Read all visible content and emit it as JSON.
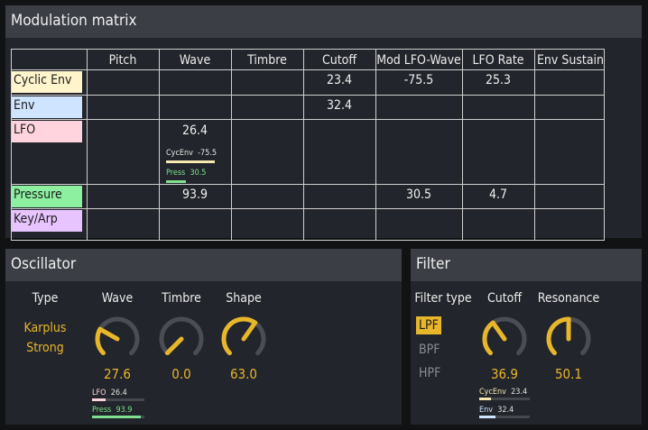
{
  "modulation": {
    "title": "Modulation matrix",
    "columns": [
      "Pitch",
      "Wave",
      "Timbre",
      "Cutoff",
      "Mod LFO-Wave",
      "LFO Rate",
      "Env Sustain"
    ],
    "rows": [
      {
        "label": "Cyclic Env",
        "color": "#fff4cc",
        "cells": [
          "",
          "",
          "",
          "23.4",
          "-75.5",
          "25.3",
          ""
        ]
      },
      {
        "label": "Env",
        "color": "#cfe4ff",
        "cells": [
          "",
          "",
          "",
          "32.4",
          "",
          "",
          ""
        ]
      },
      {
        "label": "LFO",
        "color": "#ffd4df",
        "cells": [
          "",
          "26.4",
          "",
          "",
          "",
          "",
          ""
        ]
      },
      {
        "label": "Pressure",
        "color": "#8df0a0",
        "cells": [
          "",
          "93.9",
          "",
          "",
          "30.5",
          "4.7",
          ""
        ]
      },
      {
        "label": "Key/Arp",
        "color": "#e8c4ff",
        "cells": [
          "",
          "",
          "",
          "",
          "",
          "",
          ""
        ]
      }
    ],
    "lfo_wave_submods": [
      {
        "label": "CycEnv",
        "value": "-75.5",
        "amount": -0.755,
        "color": "#f4e8b0"
      },
      {
        "label": "Press",
        "value": "30.5",
        "amount": 0.305,
        "color": "#7ee08e"
      }
    ]
  },
  "oscillator": {
    "title": "Oscillator",
    "type_label": "Type",
    "type_value_line1": "Karplus",
    "type_value_line2": "Strong",
    "knobs": [
      {
        "label": "Wave",
        "value": "27.6",
        "level": 0.276
      },
      {
        "label": "Timbre",
        "value": "0.0",
        "level": 0.0
      },
      {
        "label": "Shape",
        "value": "63.0",
        "level": 0.63
      }
    ],
    "wave_mods": [
      {
        "label": "LFO",
        "value": "26.4",
        "amount": 0.264,
        "color": "#ffd4df"
      },
      {
        "label": "Press",
        "value": "93.9",
        "amount": 0.939,
        "color": "#7ee08e"
      }
    ]
  },
  "filter": {
    "title": "Filter",
    "type_label": "Filter type",
    "types": [
      "LPF",
      "BPF",
      "HPF"
    ],
    "selected": "LPF",
    "knobs": [
      {
        "label": "Cutoff",
        "value": "36.9",
        "level": 0.369
      },
      {
        "label": "Resonance",
        "value": "50.1",
        "level": 0.501
      }
    ],
    "cutoff_mods": [
      {
        "label": "CycEnv",
        "value": "23.4",
        "amount": 0.234,
        "color": "#f4e8b0"
      },
      {
        "label": "Env",
        "value": "32.4",
        "amount": 0.324,
        "color": "#cfe4ff"
      }
    ]
  },
  "colors": {
    "accent": "#e8b62a",
    "knob_track": "#4a4d54",
    "panel": "#22252b",
    "header": "#3b3e45"
  }
}
